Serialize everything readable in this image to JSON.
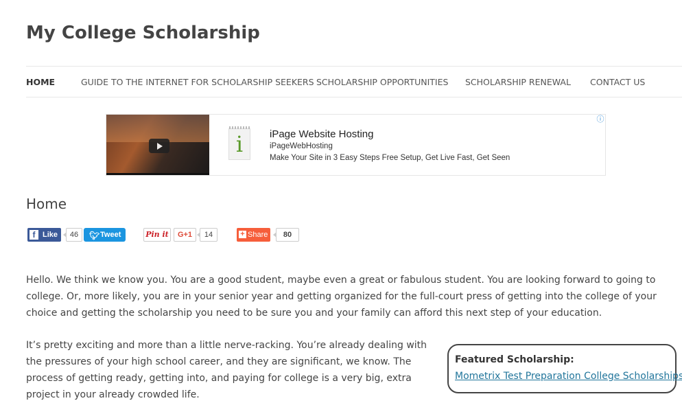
{
  "site": {
    "title": "My College Scholarship"
  },
  "nav": {
    "items": [
      {
        "label": "HOME",
        "active": true
      },
      {
        "label": "GUIDE TO THE INTERNET FOR SCHOLARSHIP SEEKERS"
      },
      {
        "label": "SCHOLARSHIP OPPORTUNITIES"
      },
      {
        "label": "SCHOLARSHIP RENEWAL"
      },
      {
        "label": "CONTACT US"
      }
    ]
  },
  "ad": {
    "title": "iPage Website Hosting",
    "domain": "iPageWebHosting",
    "description": "Make Your Site in 3 Easy Steps Free Setup, Get Live Fast, Get Seen",
    "icon_letter": "i",
    "info_glyph": "ⓘ"
  },
  "page": {
    "title": "Home"
  },
  "share": {
    "like_label": "Like",
    "like_count": "46",
    "tweet_label": "Tweet",
    "pin_label": "Pin it",
    "gplus_label": "G+1",
    "gplus_count": "14",
    "share_label": "Share",
    "share_count": "80"
  },
  "content": {
    "p1": "Hello. We think we know you. You are a good student, maybe even a great or fabulous student. You are looking forward to going to college. Or, more likely, you are in your senior year and getting organized for the full-court press of getting into the college of your choice and getting the scholarship you need to be sure you and your family can afford this next step of your education.",
    "p2": "It’s pretty exciting and more than a little nerve-racking. You’re already dealing with the pressures of your high school career, and they are significant, we know. The process of getting ready, getting into, and paying for college is a very big, extra project in your already crowded life."
  },
  "featured": {
    "label": "Featured Scholarship:",
    "link": "Mometrix Test Preparation College Scholarships"
  },
  "colors": {
    "link": "#21759b",
    "facebook": "#3b5998",
    "twitter": "#1b95e0",
    "share": "#f65e3b"
  }
}
